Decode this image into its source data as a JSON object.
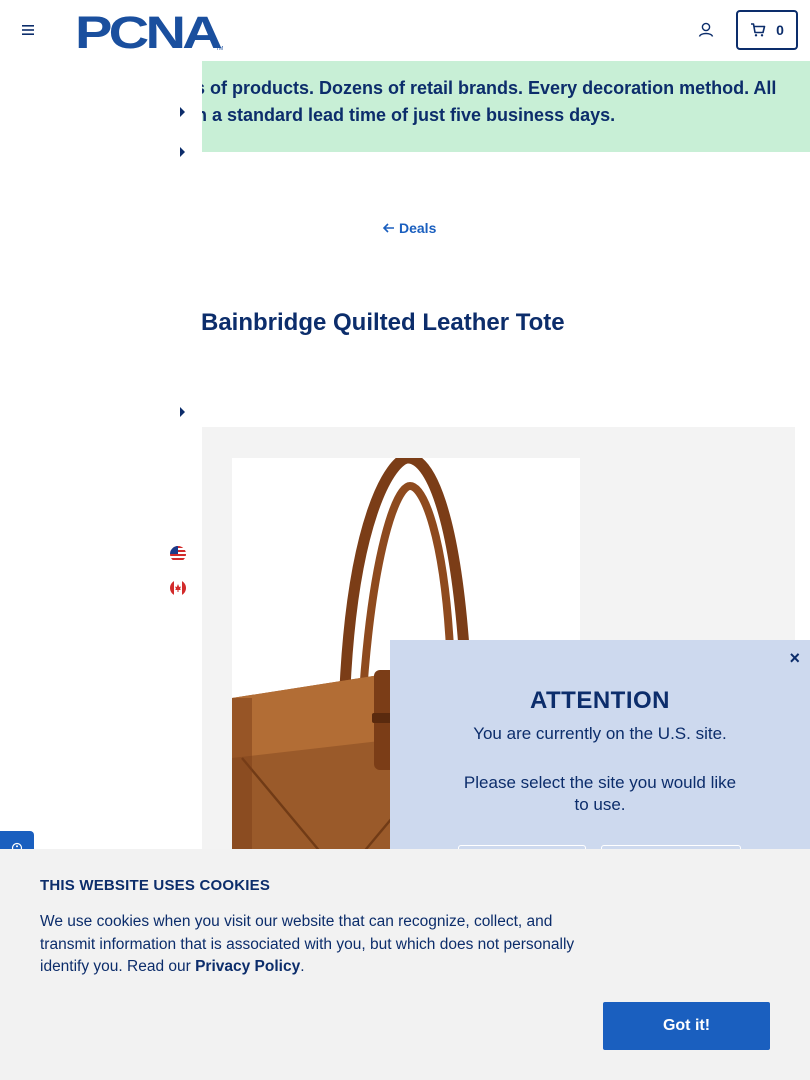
{
  "header": {
    "logo_text": "PCNA",
    "cart_count": "0"
  },
  "promo": {
    "line1": "ls of products. Dozens of retail brands. Every decoration method. All",
    "line2": "th a standard lead time of just five business days."
  },
  "back_link": {
    "label": "Deals"
  },
  "product": {
    "title": "Bainbridge Quilted Leather Tote"
  },
  "attention": {
    "title": "ATTENTION",
    "line1": "You are currently on the U.S. site.",
    "line2": "Please select the site you would like to use.",
    "close_symbol": "×"
  },
  "cookie": {
    "title": "THIS WEBSITE USES COOKIES",
    "text": "We use cookies when you visit our website that can recognize, collect, and transmit information that is associated with you, but which does not personally identify you. Read our ",
    "link_label": "Privacy Policy",
    "period": ".",
    "button_label": "Got it!"
  },
  "colors": {
    "navy": "#0c2d6b",
    "blue": "#1a5fbf",
    "promo_bg": "#c8efd6",
    "modal_bg": "#cdd9ee",
    "cookie_bg": "#f2f2f2"
  }
}
